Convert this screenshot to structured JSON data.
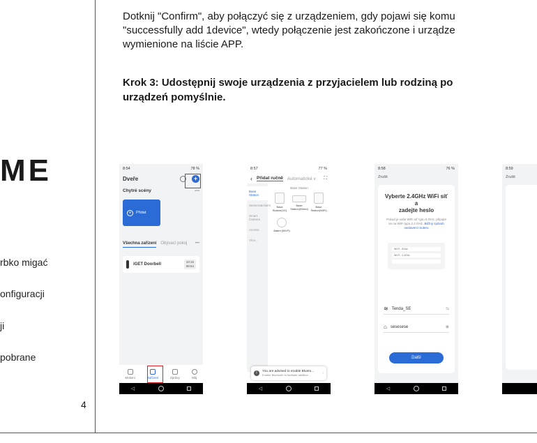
{
  "left": {
    "logo": "ME",
    "items": [
      "rbko migać",
      "onfiguracji",
      "ji",
      "pobrane"
    ],
    "page_number": "4"
  },
  "main": {
    "paragraph_lines": [
      "Dotknij \"Confirm\", aby połączyć się z urządzeniem, gdy pojawi się komu",
      "\"successfully add 1device\", wtedy połączenie jest zakończone i urządze",
      "wymienione na liście APP."
    ],
    "step_lines": [
      "Krok 3: Udostępnij swoje urządzenia z przyjacielem lub rodziną po",
      "urządzeń pomyślnie."
    ]
  },
  "phone1": {
    "time": "8:54",
    "battery": "78 %",
    "home_title": "Dveře",
    "scenes_title": "Chytré scény",
    "scenes_more": "•••",
    "add_label": "Přidat",
    "tab_all": "Všechna zařízení",
    "tab_room": "Obývací pokoj",
    "tab_more": "•••",
    "device_name": "iGET Doorbell",
    "device_time_1": "10:15",
    "device_time_2": "08:54",
    "tabbar": [
      "Motivní",
      "Zařízení",
      "Zprávy",
      "Můj"
    ],
    "accent": "#2a6bd6",
    "highlight": "#e02020"
  },
  "phone2": {
    "time": "8:57",
    "battery": "77 %",
    "tab_manual": "Přidat ručně",
    "tab_auto": "Automatické v",
    "sidebar": [
      "Base Station",
      "Sensors&Alarm",
      "Smart Camera",
      "Access",
      "Více..."
    ],
    "section": "Base Station",
    "devices": [
      "Base Station(4G)",
      "Base Station(Wired)",
      "Base Station(WiFi)"
    ],
    "alarm": "Alarm (Wi-Fi)",
    "toast_title": "You are advised to enable Blueto...",
    "toast_sub": "Enable Bluetooth to facilitate addition ..."
  },
  "phone3": {
    "time": "8:58",
    "battery": "76 %",
    "cancel": "Zrušit",
    "title_1": "Vyberte 2.4GHz WiFi síť a",
    "title_2": "zadejte heslo",
    "desc_1": "Pokud je vaše WiFi síť typu 5 GHz, připojte",
    "desc_2": "se na WiFi typu 2.4 GHz.",
    "desc_link_1": "Běžný způsob",
    "desc_link_2": "nastavení routeru",
    "illus_row_1": "Wi-Fi - 5Ghz",
    "illus_row_2": "Wi-Fi - 2.4Ghz",
    "ssid": "Tenda_SE",
    "password": "sesesese",
    "button": "Další"
  },
  "phone4": {
    "time": "8:59",
    "cancel": "Zrušit"
  }
}
